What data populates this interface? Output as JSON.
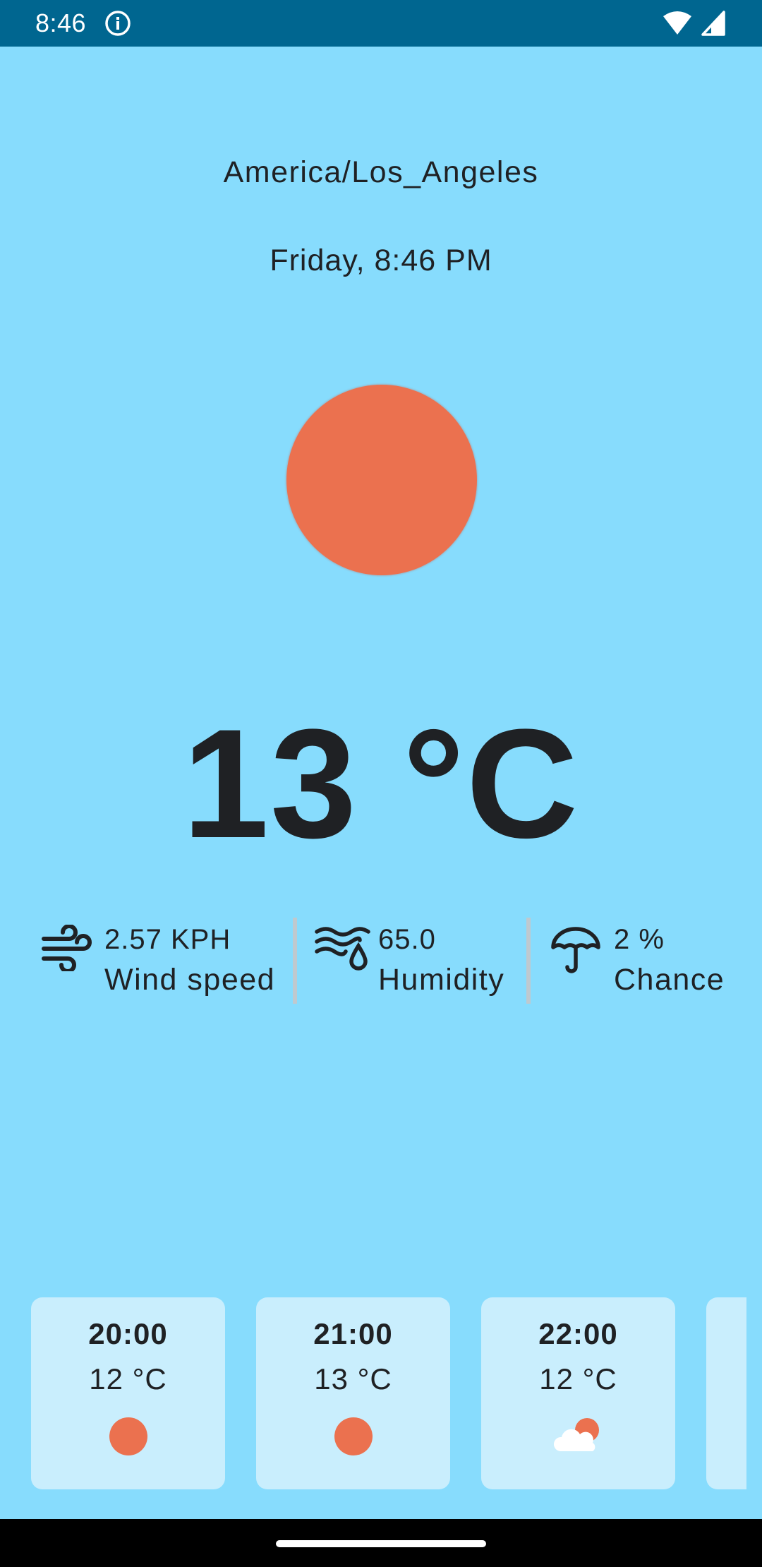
{
  "status_bar": {
    "time": "8:46"
  },
  "location": "America/Los_Angeles",
  "datetime": "Friday, 8:46 PM",
  "current": {
    "temperature": "13 °C",
    "icon": "sun-icon"
  },
  "stats": [
    {
      "icon": "wind-icon",
      "value": "2.57 KPH",
      "label": "Wind speed"
    },
    {
      "icon": "humidity-icon",
      "value": "65.0",
      "label": "Humidity"
    },
    {
      "icon": "umbrella-icon",
      "value": "2 %",
      "label": "Chance"
    }
  ],
  "forecast": [
    {
      "time": "20:00",
      "temp": "12 °C",
      "icon": "sun-icon"
    },
    {
      "time": "21:00",
      "temp": "13 °C",
      "icon": "sun-icon"
    },
    {
      "time": "22:00",
      "temp": "12 °C",
      "icon": "partly-cloudy-icon"
    }
  ],
  "colors": {
    "background": "#87dcfd",
    "status_bar": "#006690",
    "sun": "#eb714f",
    "card": "#c9eefd",
    "text": "#1f2124"
  }
}
